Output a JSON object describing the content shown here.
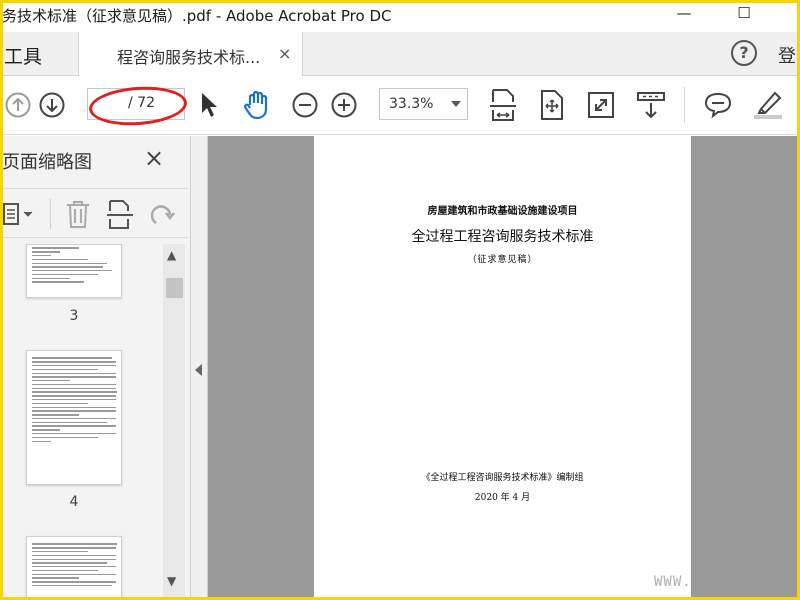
{
  "window": {
    "title": "务技术标准（征求意见稿）.pdf - Adobe Acrobat Pro DC",
    "minimize_glyph": "—",
    "maximize_glyph": "☐"
  },
  "tabs": {
    "tools_label": "工具",
    "doc_tab_label": "程咨询服务技术标...",
    "close_glyph": "×",
    "help_glyph": "?",
    "login_label": "登"
  },
  "toolbar": {
    "page_current": "",
    "page_total": "/ 72",
    "zoom_value": "33.3%",
    "icons": [
      "arrow-up-icon",
      "arrow-down-icon",
      "select-cursor-icon",
      "hand-tool-icon",
      "zoom-out-icon",
      "zoom-in-icon",
      "fit-page-icon",
      "rotate-icon",
      "fullscreen-icon",
      "scroll-mode-icon",
      "comment-icon",
      "highlight-icon"
    ]
  },
  "thumbnails": {
    "panel_title": "页面缩略图",
    "close_glyph": "×",
    "items": [
      {
        "page_label": "3"
      },
      {
        "page_label": "4"
      },
      {
        "page_label": ""
      }
    ]
  },
  "document": {
    "org_line": "房屋建筑和市政基础设施建设项目",
    "main_title": "全过程工程咨询服务技术标准",
    "subtitle": "（征求意见稿）",
    "editors": "《全过程工程咨询服务技术标准》编制组",
    "date": "2020 年 4 月"
  },
  "watermark": "WWW.",
  "colors": {
    "frame": "#f4d600",
    "annotation": "#e02020",
    "doc_background": "#9a9a9a",
    "accent_blue": "#1a73c8"
  }
}
